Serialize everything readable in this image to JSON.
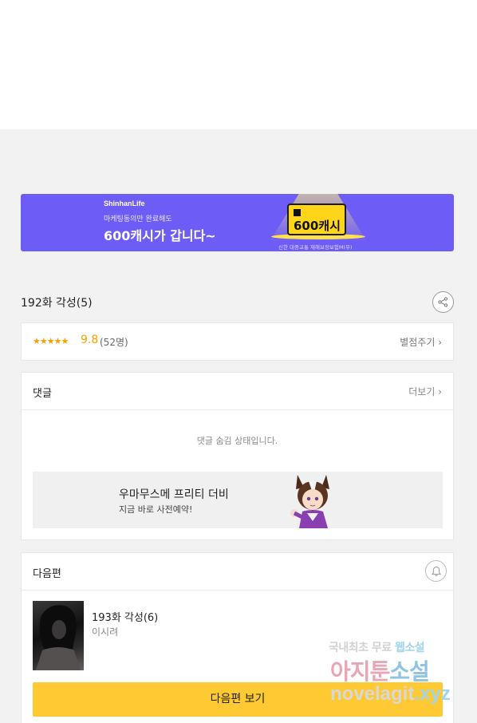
{
  "ad": {
    "brand": "ShinhanLife",
    "sub": "마케팅동의만 완료해도",
    "main": "600캐시가 갑니다~",
    "card_text": "600캐시",
    "fine": "신한 대중교통 재해보장보험M(무)",
    "accent_color": "#6e5cf7"
  },
  "episode": {
    "title": "192화 각성(5)"
  },
  "rating": {
    "stars": "★★★★★",
    "score": "9.8",
    "count": "(52명)",
    "rate_link": "별점주기 ›"
  },
  "comments": {
    "title": "댓글",
    "more_link": "더보기 ›",
    "hidden_message": "댓글 숨김 상태입니다."
  },
  "promo": {
    "title": "우마무스메 프리티 더비",
    "subtitle": "지금 바로 사전예약!"
  },
  "next_episode": {
    "header": "다음편",
    "title": "193화 각성(6)",
    "author": "이시려",
    "button_label": "다음편 보기"
  },
  "watermark": {
    "line1_a": "국내최초 무료 ",
    "line1_b": "웹소설",
    "line2_a": "아지툰",
    "line2_b": "소설",
    "line3_a": "novelagit",
    "line3_b": ".xyz"
  },
  "icons": {
    "share": "share-icon",
    "bell": "bell-icon"
  },
  "colors": {
    "star": "#f5a100",
    "next_button": "#ffc933"
  }
}
